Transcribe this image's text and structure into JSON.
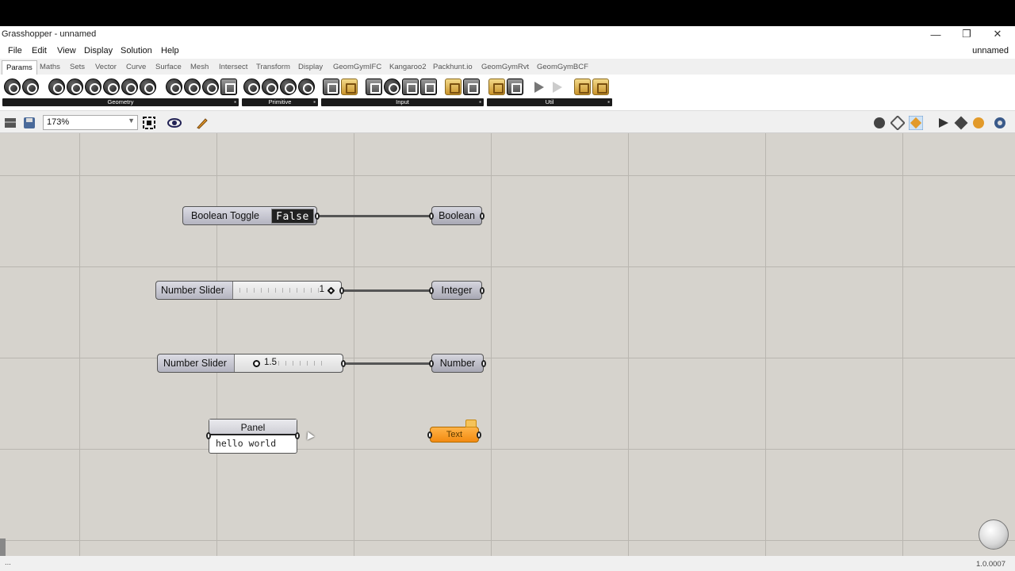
{
  "window": {
    "title": "Grasshopper - unnamed",
    "controls": [
      "minimize-icon",
      "restore-icon",
      "close-icon"
    ]
  },
  "menu": {
    "items": [
      "File",
      "Edit",
      "View",
      "Display",
      "Solution",
      "Help"
    ],
    "document_name": "unnamed"
  },
  "tabs": [
    "Params",
    "Maths",
    "Sets",
    "Vector",
    "Curve",
    "Surface",
    "Mesh",
    "Intersect",
    "Transform",
    "Display",
    "GeomGymIFC",
    "Kangaroo2",
    "Packhunt.io",
    "GeomGymRvt",
    "GeomGymBCF"
  ],
  "active_tab": "Params",
  "ribbon_groups": [
    {
      "label": "Geometry"
    },
    {
      "label": "Primitive"
    },
    {
      "label": "Input"
    },
    {
      "label": "Util"
    }
  ],
  "toolbar": {
    "zoom": "173%"
  },
  "canvas": {
    "components": {
      "boolean_toggle": {
        "label": "Boolean Toggle",
        "value": "False"
      },
      "boolean_param": {
        "label": "Boolean"
      },
      "int_slider": {
        "label": "Number Slider",
        "value": "1"
      },
      "integer_param": {
        "label": "Integer"
      },
      "num_slider": {
        "label": "Number Slider",
        "value": "1.5"
      },
      "number_param": {
        "label": "Number"
      },
      "panel": {
        "title": "Panel",
        "content": "hello world"
      },
      "text_param": {
        "label": "Text",
        "color": "#f38b12"
      }
    }
  },
  "status": {
    "left": "...",
    "version": "1.0.0007"
  }
}
